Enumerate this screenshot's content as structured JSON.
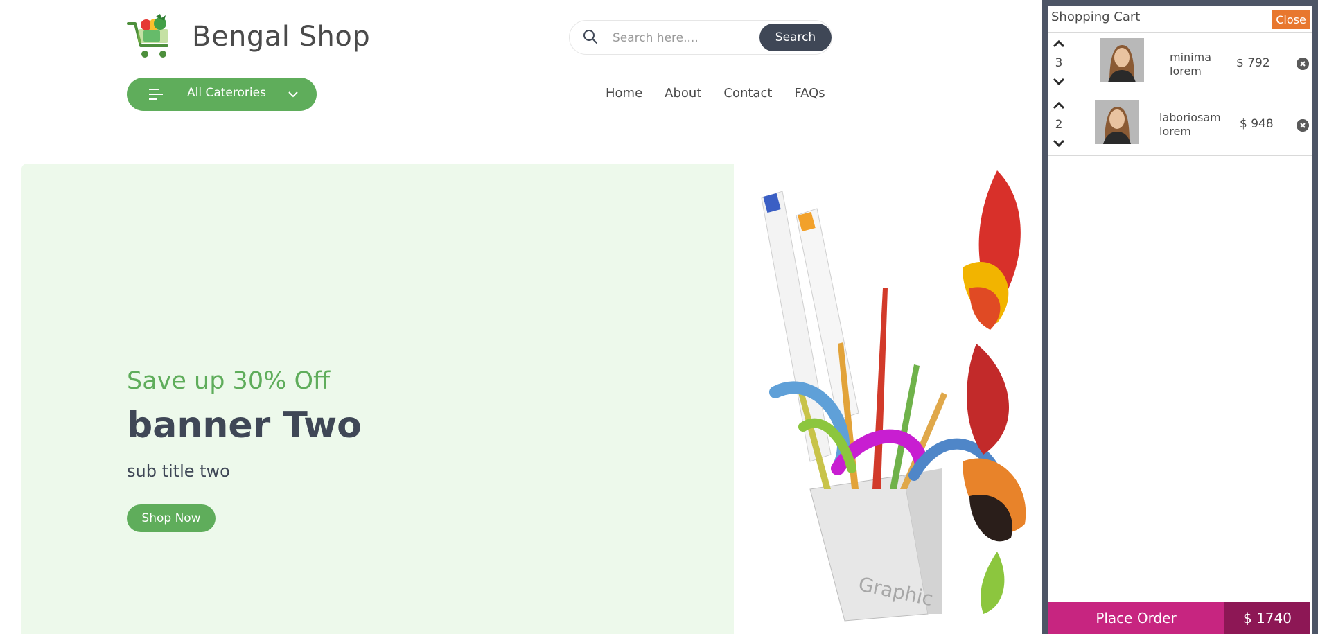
{
  "header": {
    "logo_text": "Bengal Shop",
    "search": {
      "placeholder": "Search here....",
      "button_label": "Search"
    },
    "categories_label": "All Caterories",
    "nav": [
      "Home",
      "About",
      "Contact",
      "FAQs"
    ]
  },
  "banner": {
    "subtitle": "Save up 30% Off",
    "title": "banner Two",
    "caption": "sub title two",
    "button_label": "Shop Now",
    "art_label": "Graphic"
  },
  "cart": {
    "title": "Shopping Cart",
    "close_label": "Close",
    "items": [
      {
        "qty": "3",
        "name_line1": "minima",
        "name_line2": "lorem",
        "price": "$ 792"
      },
      {
        "qty": "2",
        "name_line1": "laboriosam",
        "name_line2": "lorem",
        "price": "$ 948"
      }
    ],
    "place_order_label": "Place Order",
    "total": "$ 1740"
  },
  "colors": {
    "accent_green": "#5fad5b",
    "dark_slate": "#3f4756",
    "banner_bg": "#edf9eb",
    "close_orange": "#e8772e",
    "order_pink": "#c72580",
    "order_dark": "#8d1755"
  }
}
